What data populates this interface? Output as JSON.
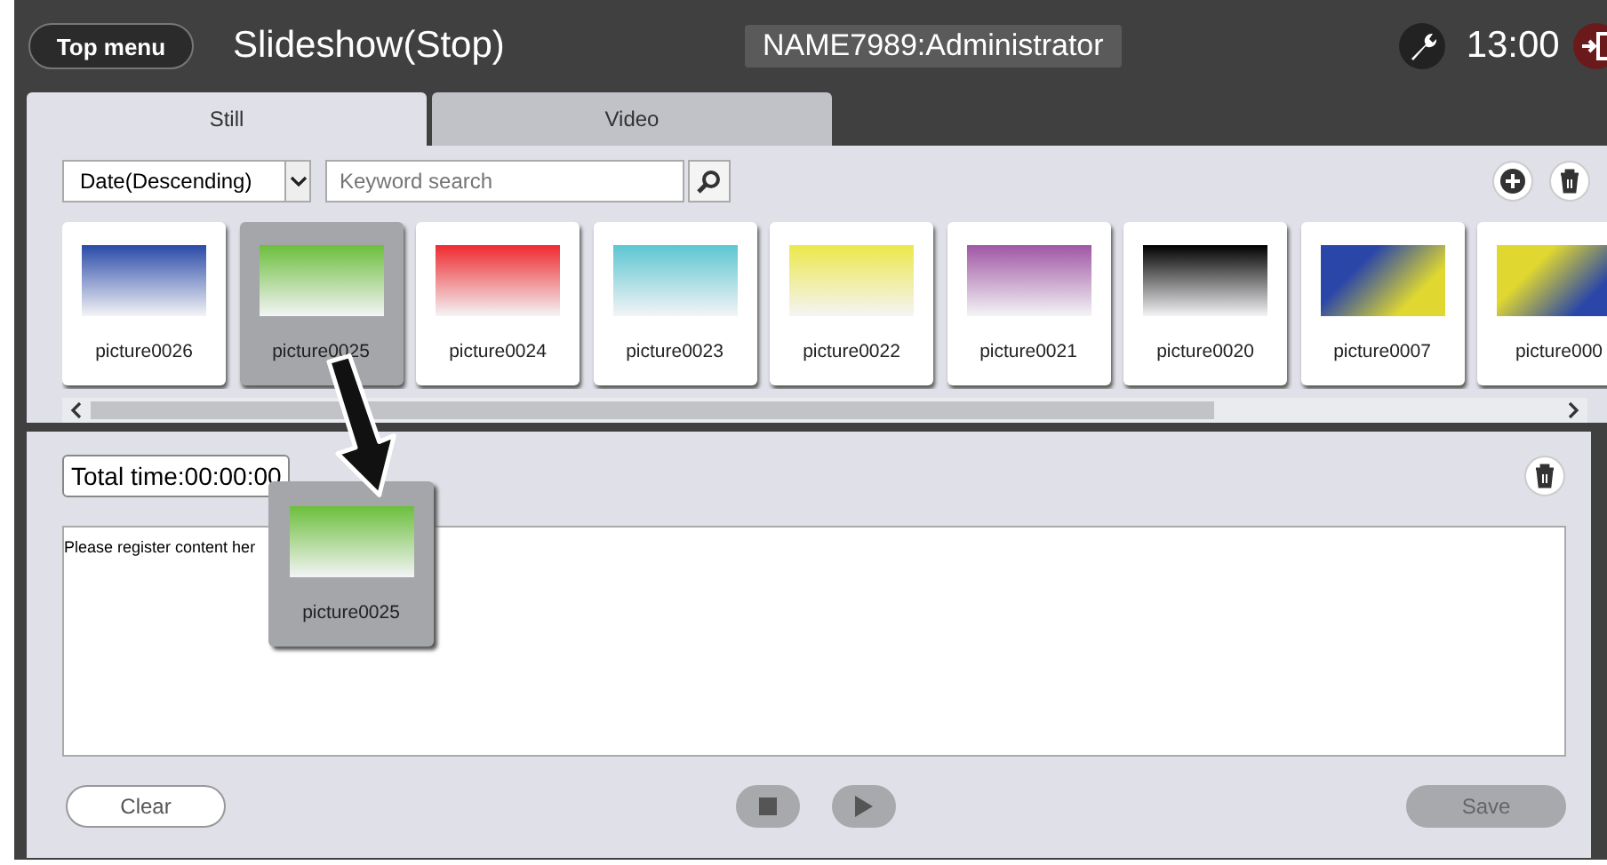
{
  "header": {
    "top_menu": "Top menu",
    "title": "Slideshow(Stop)",
    "user": "NAME7989:Administrator",
    "time": "13:00"
  },
  "tabs": [
    {
      "label": "Still",
      "selected": true
    },
    {
      "label": "Video",
      "selected": false
    }
  ],
  "toolbar": {
    "sort": "Date(Descending)",
    "search_placeholder": "Keyword search"
  },
  "thumbnails": [
    {
      "name": "picture0026",
      "kind": "fade",
      "color": "#2a4aa8",
      "selected": false
    },
    {
      "name": "picture0025",
      "kind": "fade",
      "color": "#6cbf3c",
      "selected": true
    },
    {
      "name": "picture0024",
      "kind": "fade",
      "color": "#ee2a2e",
      "selected": false
    },
    {
      "name": "picture0023",
      "kind": "fade",
      "color": "#5cc6d2",
      "selected": false
    },
    {
      "name": "picture0022",
      "kind": "fade",
      "color": "#ece84a",
      "selected": false
    },
    {
      "name": "picture0021",
      "kind": "fade",
      "color": "#a056a4",
      "selected": false
    },
    {
      "name": "picture0020",
      "kind": "fade",
      "color": "#000000",
      "selected": false
    },
    {
      "name": "picture0007",
      "kind": "diagonal",
      "color": "#2a46a8",
      "blend": {
        "color": "#e0d830"
      },
      "selected": false
    },
    {
      "name": "picture000",
      "kind": "diagonal",
      "color": "#e0d830",
      "blend": {
        "color": "#2a46a8"
      },
      "selected": false
    }
  ],
  "playlist": {
    "total_time": "Total time:00:00:00",
    "hint": "Please register content her"
  },
  "dragged": {
    "name": "picture0025",
    "kind": "fade",
    "color": "#6cbf3c"
  },
  "buttons": [
    {
      "kind": "clear",
      "label": "Clear",
      "disabled": false
    },
    {
      "kind": "stop",
      "disabled": true
    },
    {
      "kind": "play",
      "disabled": true
    },
    {
      "kind": "save",
      "label": "Save",
      "disabled": true
    }
  ]
}
